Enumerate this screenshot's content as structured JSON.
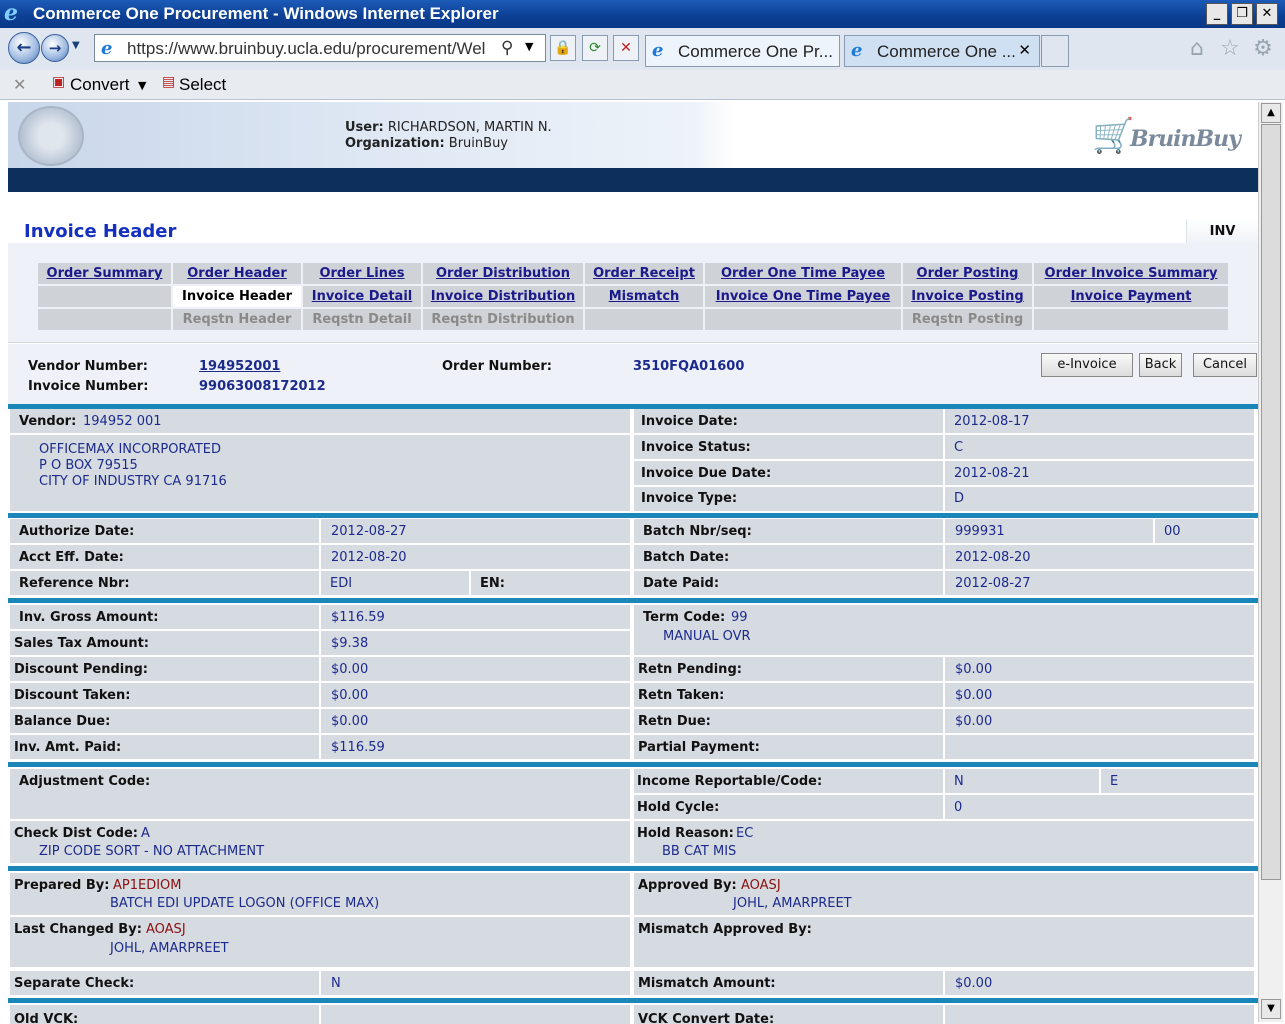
{
  "browser": {
    "title": "Commerce One Procurement - Windows Internet Explorer",
    "url": "https://www.bruinbuy.ucla.edu/procurement/Wel",
    "tabs": [
      {
        "label": "Commerce One Pr..."
      },
      {
        "label": "Commerce One ..."
      }
    ],
    "commands": {
      "convert": "Convert",
      "select": "Select"
    }
  },
  "header": {
    "user_label": "User:",
    "user": "RICHARDSON, MARTIN N.",
    "org_label": "Organization:",
    "org": "BruinBuy",
    "logo_text": "BruinBuy"
  },
  "page": {
    "title": "Invoice Header",
    "tab_code": "INV"
  },
  "nav": {
    "row1": [
      "Order Summary",
      "Order Header",
      "Order Lines",
      "Order Distribution",
      "Order Receipt",
      "Order One Time Payee",
      "Order Posting",
      "Order Invoice Summary"
    ],
    "row2": [
      "",
      "Invoice Header",
      "Invoice Detail",
      "Invoice Distribution",
      "Mismatch",
      "Invoice One Time Payee",
      "Invoice Posting",
      "Invoice Payment"
    ],
    "row3": [
      "",
      "Reqstn Header",
      "Reqstn Detail",
      "Reqstn Distribution",
      "",
      "",
      "Reqstn Posting",
      ""
    ]
  },
  "summary": {
    "vendor_number_label": "Vendor Number:",
    "vendor_number": "194952001",
    "invoice_number_label": "Invoice Number:",
    "invoice_number": "99063008172012",
    "order_number_label": "Order Number:",
    "order_number": "3510FQA01600",
    "buttons": {
      "einvoice": "e-Invoice",
      "back": "Back",
      "cancel": "Cancel"
    }
  },
  "vendor": {
    "label": "Vendor:",
    "id": "194952 001",
    "address": [
      "OFFICEMAX INCORPORATED",
      "P O BOX 79515",
      "CITY OF INDUSTRY   CA 91716"
    ]
  },
  "invoice": {
    "date_label": "Invoice Date:",
    "date": "2012-08-17",
    "status_label": "Invoice Status:",
    "status": "C",
    "due_label": "Invoice Due Date:",
    "due": "2012-08-21",
    "type_label": "Invoice Type:",
    "type": "D"
  },
  "dates": {
    "authorize_label": "Authorize Date:",
    "authorize": "2012-08-27",
    "acct_eff_label": "Acct Eff. Date:",
    "acct_eff": "2012-08-20",
    "reference_label": "Reference Nbr:",
    "reference": "EDI",
    "en_label": "EN:",
    "batch_seq_label": "Batch Nbr/seq:",
    "batch_nbr": "999931",
    "batch_seq": "00",
    "batch_date_label": "Batch Date:",
    "batch_date": "2012-08-20",
    "date_paid_label": "Date Paid:",
    "date_paid": "2012-08-27"
  },
  "amounts": {
    "gross_label": "Inv. Gross Amount:",
    "gross": "$116.59",
    "tax_label": "Sales Tax Amount:",
    "tax": "$9.38",
    "disc_pending_label": "Discount Pending:",
    "disc_pending": "$0.00",
    "disc_taken_label": "Discount Taken:",
    "disc_taken": "$0.00",
    "balance_label": "Balance Due:",
    "balance": "$0.00",
    "paid_label": "Inv. Amt. Paid:",
    "paid": "$116.59",
    "term_label": "Term Code:",
    "term_code": "99",
    "term_desc": "MANUAL OVR",
    "retn_pending_label": "Retn Pending:",
    "retn_pending": "$0.00",
    "retn_taken_label": "Retn Taken:",
    "retn_taken": "$0.00",
    "retn_due_label": "Retn Due:",
    "retn_due": "$0.00",
    "partial_label": "Partial Payment:"
  },
  "codes": {
    "adjustment_label": "Adjustment Code:",
    "income_label": "Income Reportable/Code:",
    "income_flag": "N",
    "income_code": "E",
    "hold_cycle_label": "Hold Cycle:",
    "hold_cycle": "0",
    "check_dist_label": "Check Dist Code:",
    "check_dist": "A",
    "check_dist_desc": "ZIP CODE SORT - NO ATTACHMENT",
    "hold_reason_label": "Hold Reason:",
    "hold_reason": "EC",
    "hold_reason_desc": "BB CAT MIS"
  },
  "audit": {
    "prepared_label": "Prepared By:",
    "prepared_id": "AP1EDIOM",
    "prepared_name": "BATCH EDI UPDATE LOGON (OFFICE MAX)",
    "approved_label": "Approved By:",
    "approved_id": "AOASJ",
    "approved_name": "JOHL, AMARPREET",
    "changed_label": "Last Changed By:",
    "changed_id": "AOASJ",
    "changed_name": "JOHL, AMARPREET",
    "mismatch_approved_label": "Mismatch Approved By:",
    "separate_label": "Separate Check:",
    "separate": "N",
    "mismatch_amount_label": "Mismatch Amount:",
    "mismatch_amount": "$0.00",
    "old_vck_label": "Old VCK:",
    "vck_convert_label": "VCK Convert Date:"
  }
}
